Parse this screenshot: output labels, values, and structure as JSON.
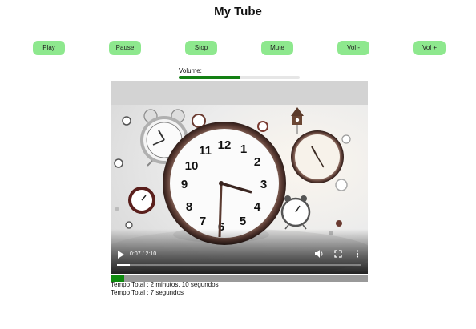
{
  "app": {
    "title": "My Tube"
  },
  "controls": {
    "play": "Play",
    "pause": "Pause",
    "stop": "Stop",
    "mute": "Mute",
    "vol_down": "Vol -",
    "vol_up": "Vol +"
  },
  "volume": {
    "label": "Volume:",
    "level": 0.5
  },
  "video": {
    "time_display": "0:07 / 2:10",
    "current_seconds": 7,
    "duration_seconds": 130,
    "icons": {
      "play": "play-icon",
      "volume": "volume-icon",
      "fullscreen": "fullscreen-icon",
      "more": "more-options-icon"
    }
  },
  "progress": {
    "fraction": 0.054
  },
  "info": {
    "total_time": "Tempo Total : 2 minutos, 10 segundos",
    "elapsed_time": "Tempo Total : 7 segundos"
  },
  "colors": {
    "button": "#8ee88e",
    "volume_fill": "#138013",
    "progress_fill": "#0e8a0e",
    "progress_track": "#999999"
  }
}
